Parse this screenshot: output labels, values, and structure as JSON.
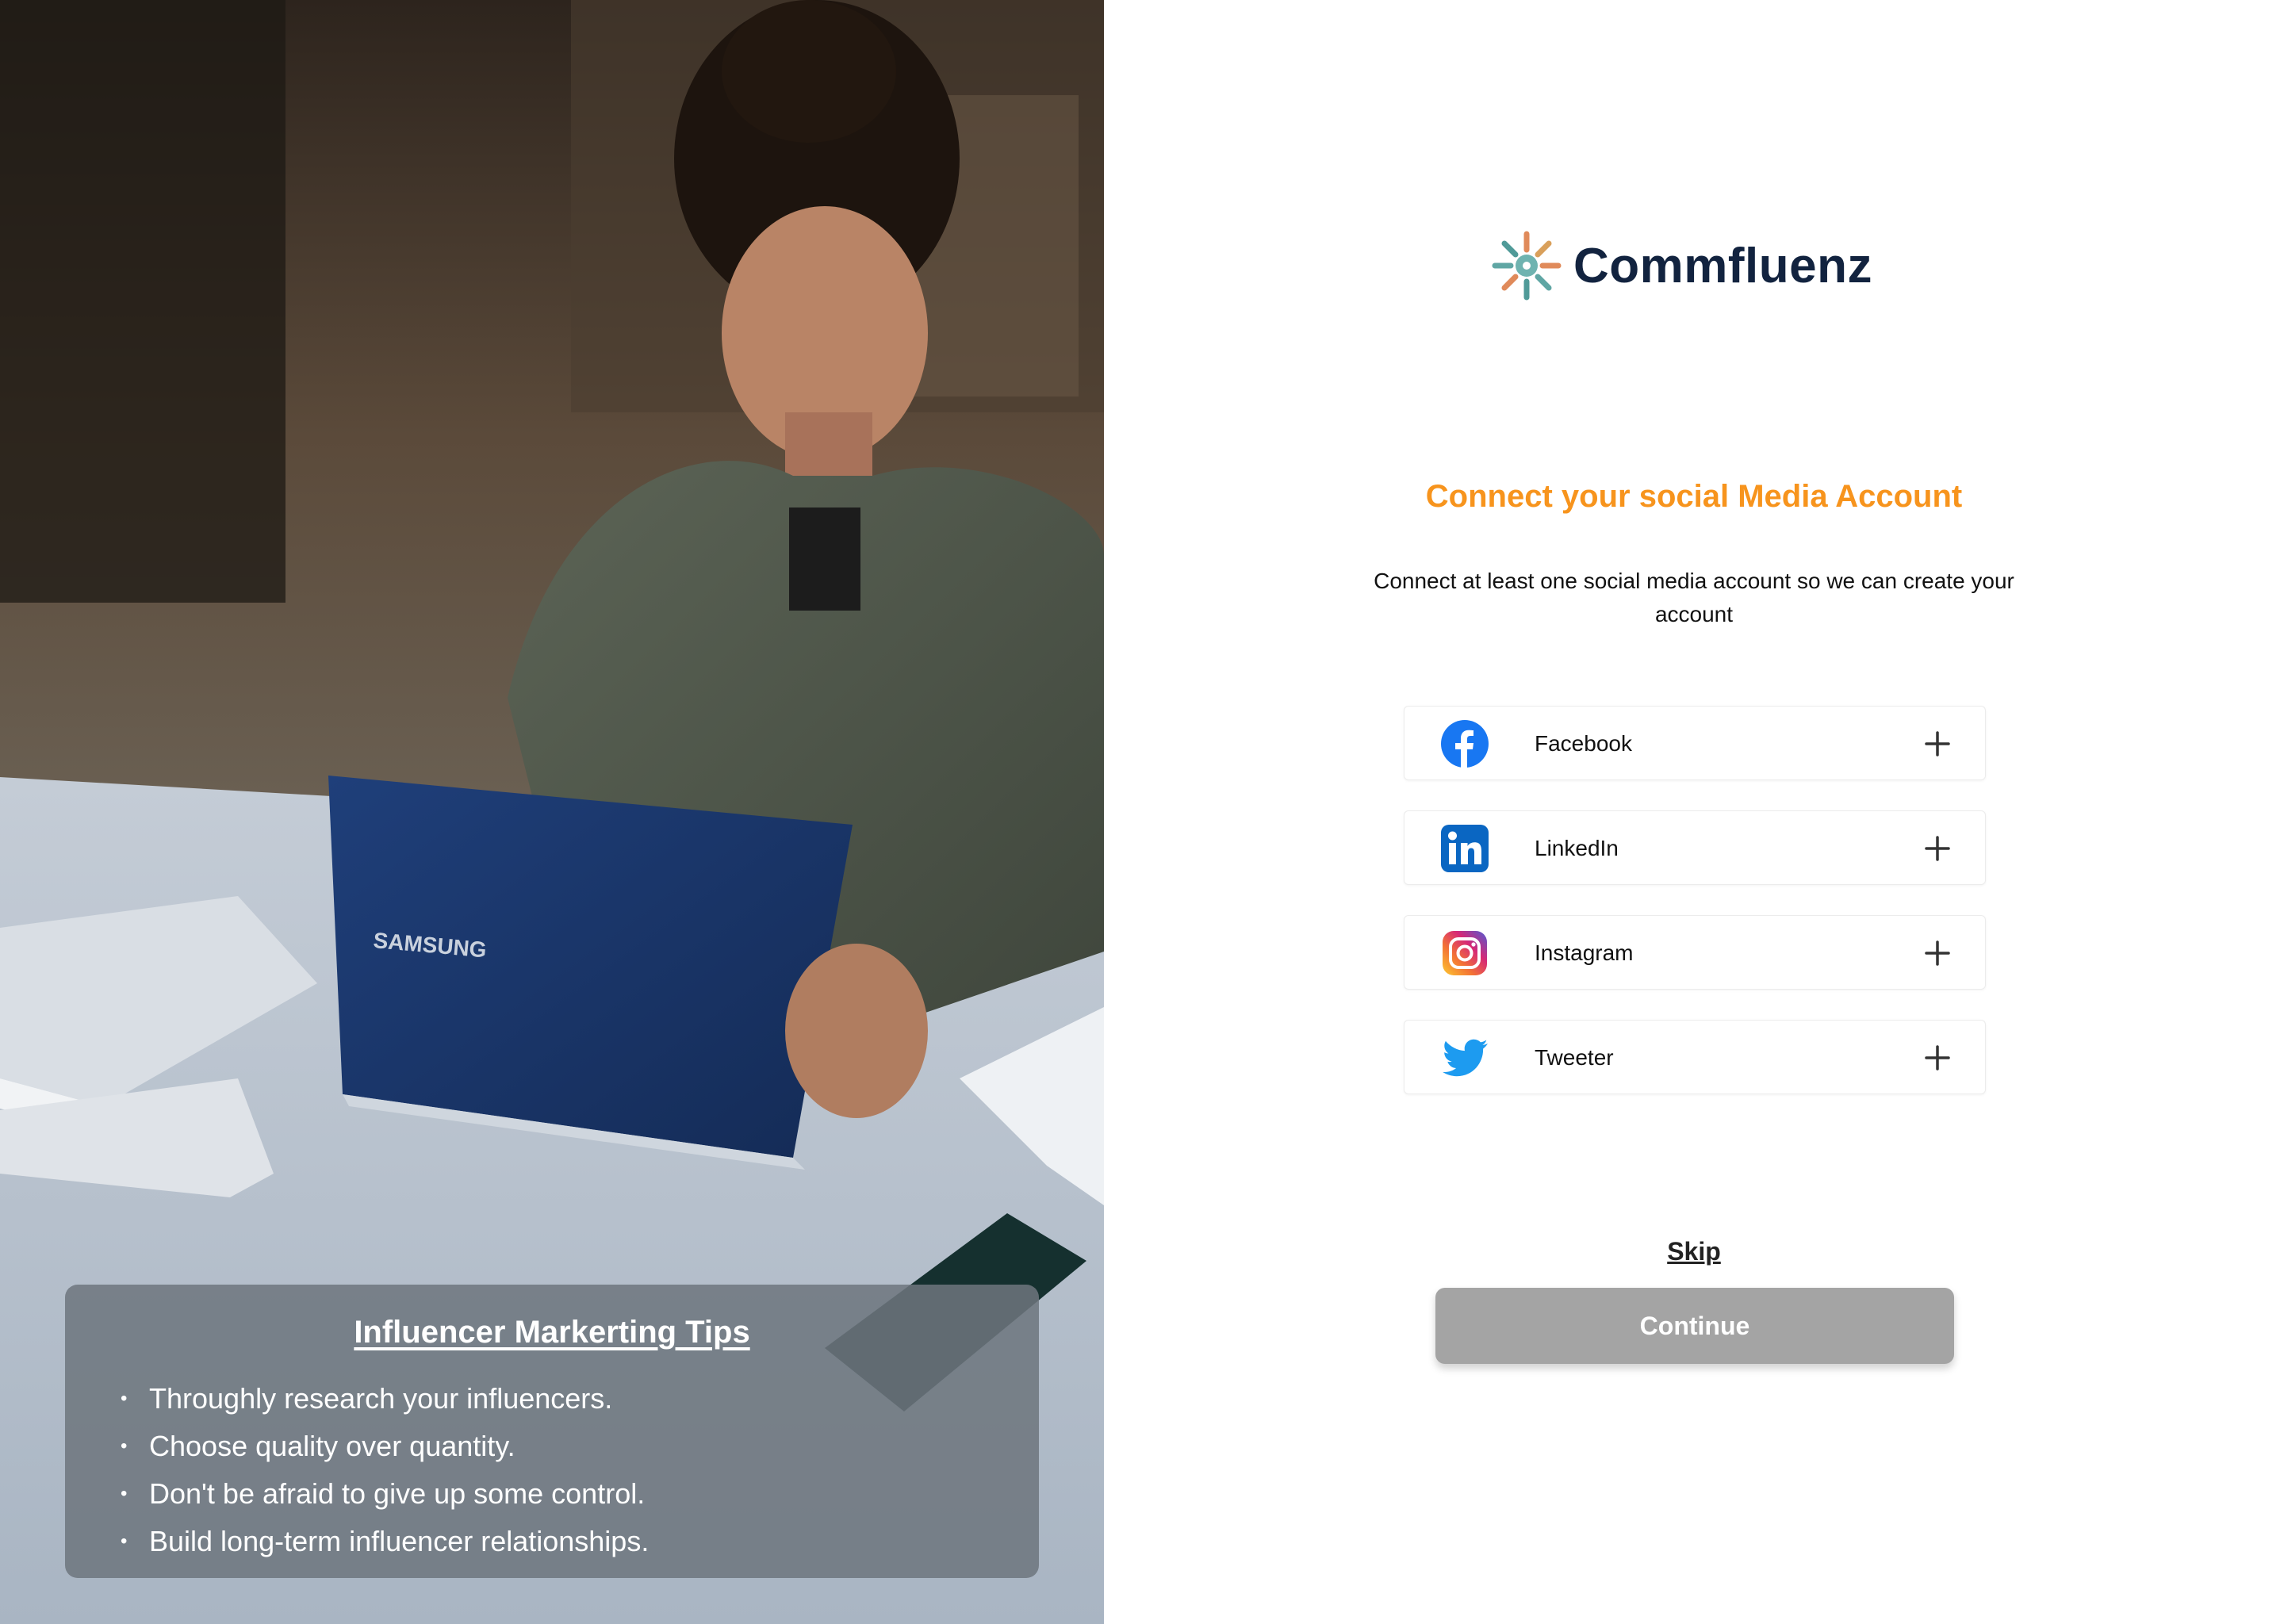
{
  "brand": {
    "name": "Commfluenz",
    "logo_icon": "commfluenz-logo-icon"
  },
  "hero": {
    "photo": "woman-working-on-laptop-photo"
  },
  "tips": {
    "title": "Influencer Markerting Tips",
    "items": [
      "Throughly research your influencers.",
      "Choose quality over quantity.",
      "Don't be afraid to give up some control.",
      "Build long-term influencer relationships."
    ]
  },
  "heading": "Connect your social Media Account",
  "subtext": "Connect at least one social media  account so we can create your account",
  "social_accounts": [
    {
      "label": "Facebook",
      "icon": "facebook-icon"
    },
    {
      "label": "LinkedIn",
      "icon": "linkedin-icon"
    },
    {
      "label": "Instagram",
      "icon": "instagram-icon"
    },
    {
      "label": "Tweeter",
      "icon": "twitter-icon"
    }
  ],
  "skip_label": "Skip",
  "continue_label": "Continue",
  "colors": {
    "accent": "#f7941d",
    "brand_text": "#12233f",
    "continue_disabled": "#a4a4a4",
    "facebook": "#1877f2",
    "linkedin": "#0a66c2",
    "twitter": "#1d9bf0"
  }
}
